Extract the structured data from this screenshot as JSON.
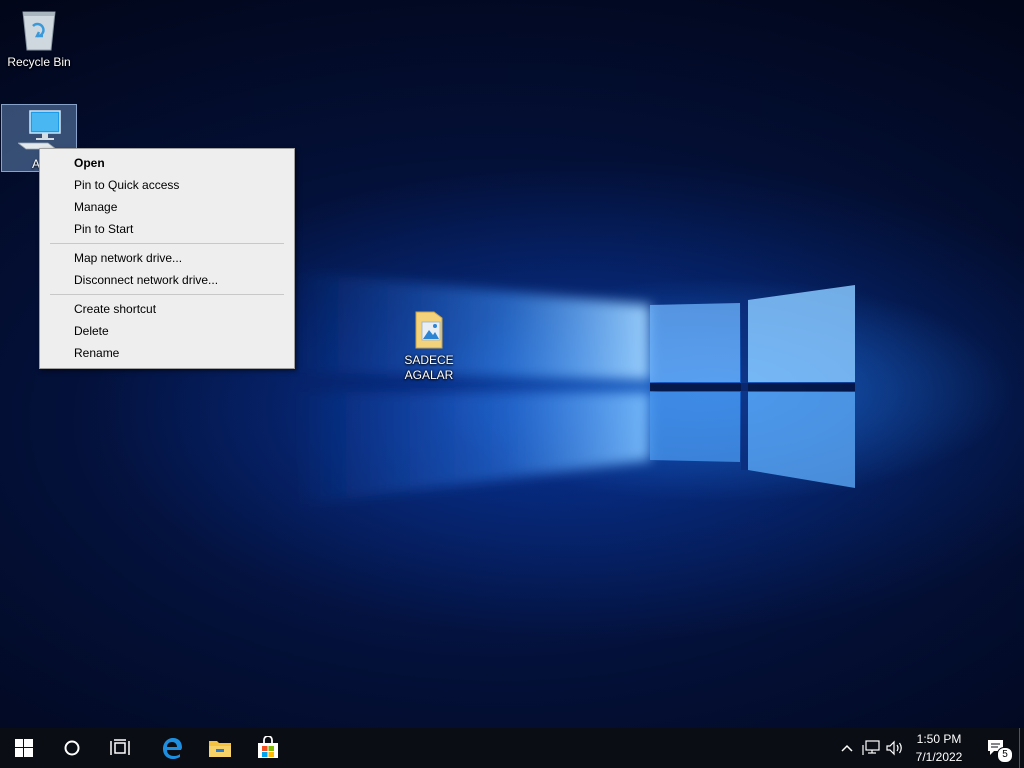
{
  "desktop": {
    "icons": [
      {
        "label": "Recycle Bin",
        "icon": "recycle-bin-icon"
      },
      {
        "label": "A",
        "icon": "this-pc-icon"
      },
      {
        "label": "SADECE AGALAR",
        "icon": "folder-pictures-icon"
      }
    ]
  },
  "context_menu": {
    "items": [
      {
        "label": "Open"
      },
      {
        "label": "Pin to Quick access"
      },
      {
        "label": "Manage"
      },
      {
        "label": "Pin to Start"
      },
      {
        "label": "Map network drive..."
      },
      {
        "label": "Disconnect network drive..."
      },
      {
        "label": "Create shortcut"
      },
      {
        "label": "Delete"
      },
      {
        "label": "Rename"
      }
    ]
  },
  "taskbar": {
    "buttons": [
      "start-icon",
      "cortana-search-icon",
      "task-view-icon",
      "edge-icon",
      "file-explorer-icon",
      "store-icon"
    ],
    "tray_icons": [
      "chevron-up-icon",
      "network-icon",
      "volume-icon"
    ],
    "clock": {
      "time": "1:50 PM",
      "date": "7/1/2022"
    },
    "notifications": {
      "count": "5"
    }
  },
  "colors": {
    "taskbar": "#0a0d14",
    "menu_bg": "#eeeeee",
    "accent": "#0078d7"
  }
}
